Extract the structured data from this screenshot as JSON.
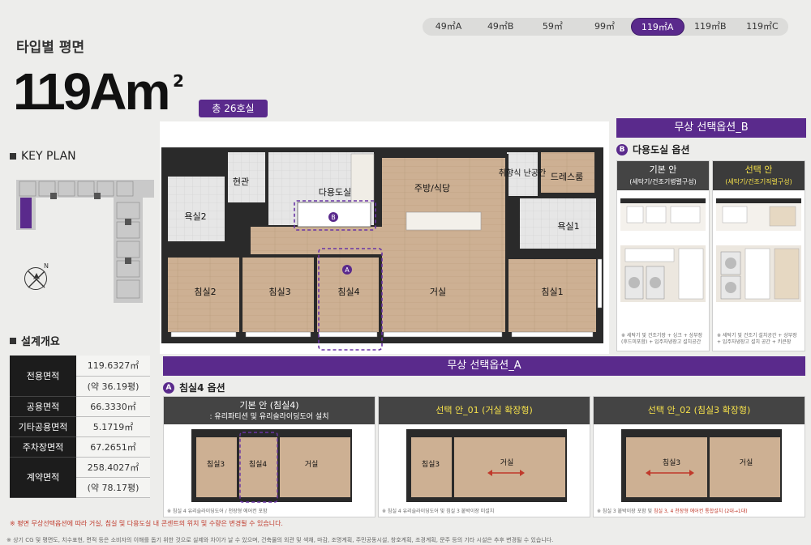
{
  "tabs": [
    {
      "label": "49㎡A",
      "active": false
    },
    {
      "label": "49㎡B",
      "active": false
    },
    {
      "label": "59㎡",
      "active": false
    },
    {
      "label": "99㎡",
      "active": false
    },
    {
      "label": "119㎡A",
      "active": true
    },
    {
      "label": "119㎡B",
      "active": false
    },
    {
      "label": "119㎡C",
      "active": false
    }
  ],
  "page_title": "타입별 평면",
  "type": {
    "name": "119Am",
    "sup": "2",
    "units": "총 26호실"
  },
  "key_plan": {
    "label": "KEY PLAN",
    "compass": "N"
  },
  "spec": {
    "label": "설계개요",
    "rows": [
      {
        "label": "전용면적",
        "value": "119.6327㎡",
        "sub": "(약 36.19평)"
      },
      {
        "label": "공용면적",
        "value": "66.3330㎡"
      },
      {
        "label": "기타공용면적",
        "value": "5.1719㎡"
      },
      {
        "label": "주차장면적",
        "value": "67.2651㎡"
      },
      {
        "label": "계약면적",
        "value": "258.4027㎡",
        "sub": "(약 78.17평)"
      }
    ]
  },
  "plan": {
    "rooms": {
      "entrance": "현관",
      "utility": "다용도실",
      "kitchen": "주방/식당",
      "fragrance": "취향식\n난공간",
      "dressroom": "드레스룸",
      "bath2": "욕실2",
      "bath1": "욕실1",
      "bed2": "침실2",
      "bed3": "침실3",
      "bed4": "침실4",
      "living": "거실",
      "bed1": "침실1"
    },
    "marker_a": "A",
    "marker_b": "B"
  },
  "option_b": {
    "header": "무상 선택옵션_B",
    "marker": "B",
    "title": "다용도실 옵션",
    "basic": {
      "title": "기본 안",
      "sub": "(세탁기/건조기병렬구성)",
      "note": "※ 세탁기 및 건조기장 + 싱크 + 상부장(후드미포함) + 입주자냉장고 설치공간"
    },
    "select": {
      "title": "선택 안",
      "sub": "(세탁기/건조기직렬구성)",
      "note": "※ 세탁기 및 건조기 설치공간 + 상부장 + 입주자냉장고 설치 공간 + 키큰장"
    }
  },
  "option_a": {
    "header": "무상 선택옵션_A",
    "marker": "A",
    "title": "침실4 옵션",
    "panels": [
      {
        "title": "기본 안 (침실4)",
        "sub": ": 유리파티션 및 유리슬라이딩도어 설치",
        "selected": false,
        "labels": [
          "침실3",
          "침실4",
          "거실"
        ],
        "note": "※ 침실 4 유리슬라이딩도어 / 천장형 에어컨 포함",
        "note_red": ""
      },
      {
        "title": "선택 안_01 (거실 확장형)",
        "sub": "",
        "selected": true,
        "labels": [
          "침실3",
          "거실"
        ],
        "note": "※ 침실 4 유리슬라이딩도어 및 침실 3 붙박이장 미설치",
        "note_red": ""
      },
      {
        "title": "선택 안_02 (침실3 확장형)",
        "sub": "",
        "selected": true,
        "labels": [
          "침실3",
          "거실"
        ],
        "note": "※ 침실 3 붙박이장 포함 및 ",
        "note_red": "침실 3, 4 천장형 에어컨 통합설치 (2대→1대)"
      }
    ]
  },
  "footnotes": {
    "red": "※ 평면 무상선택옵션에 따라 거실, 침실 및 다용도실 내 콘센트의 위치 및 수량은 변경될 수 있습니다.",
    "grey": "※ 상기 CG 및 평면도, 치수표현, 면적 등은 소비자의 이해를 돕기 위한 것으로 실제와 차이가 날 수 있으며, 건축물의 외관 및 색채, 마감, 조명계획, 주민공동시설, 창호계획, 조경계획, 문주 등의 기타 시설은 추후 변경될 수 있습니다."
  },
  "colors": {
    "accent": "#5a2a8c",
    "dark": "#1c1c1c",
    "highlight": "#f5e04a",
    "floor": "#c8a98a",
    "wall": "#2a2a2a"
  }
}
